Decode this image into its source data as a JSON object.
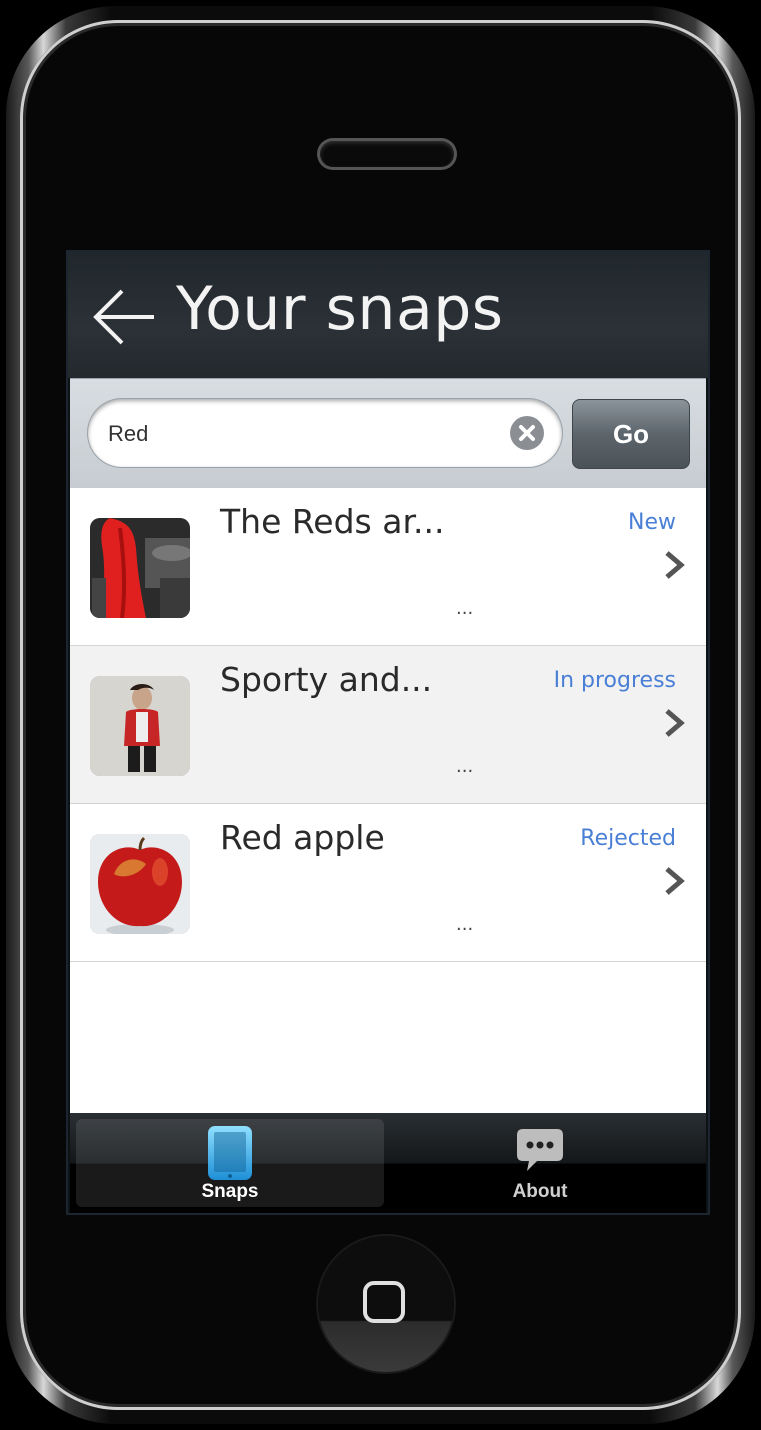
{
  "header": {
    "title": "Your snaps",
    "back_icon": "back-arrow-icon"
  },
  "search": {
    "value": "Red",
    "placeholder": "",
    "go_label": "Go"
  },
  "snaps": [
    {
      "title": "The Reds ar...",
      "status": "New",
      "description": "...",
      "thumbnail": "red-jacket-photo"
    },
    {
      "title": "Sporty and...",
      "status": "In progress",
      "description": "...",
      "thumbnail": "person-photo"
    },
    {
      "title": "Red apple",
      "status": "Rejected",
      "description": "...",
      "thumbnail": "red-apple-photo"
    }
  ],
  "tabs": [
    {
      "label": "Snaps",
      "icon": "tablet-icon",
      "active": true
    },
    {
      "label": "About",
      "icon": "speech-bubble-icon",
      "active": false
    }
  ],
  "colors": {
    "status_text": "#4a7fd6",
    "header_bg": "#2b3136"
  }
}
